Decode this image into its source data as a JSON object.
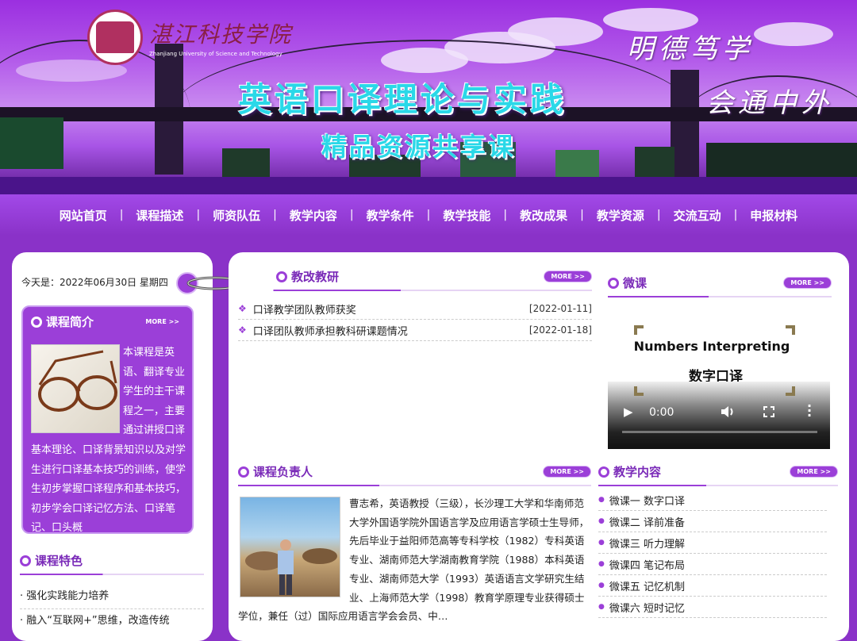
{
  "header": {
    "school_name": "湛江科技学院",
    "school_name_en": "Zhanjiang University of Science and Technology",
    "title": "英语口译理论与实践",
    "subtitle": "精品资源共享课",
    "motto_1": "明德笃学",
    "motto_2": "会通中外"
  },
  "nav": {
    "items": [
      "网站首页",
      "课程描述",
      "师资队伍",
      "教学内容",
      "教学条件",
      "教学技能",
      "教改成果",
      "教学资源",
      "交流互动",
      "申报材料"
    ],
    "separator": "|"
  },
  "sidebar": {
    "date_line": "今天是：2022年06月30日 星期四",
    "intro": {
      "title": "课程简介",
      "more": "MORE >>",
      "text": "本课程是英语、翻译专业学生的主干课程之一，主要通过讲授口译基本理论、口译背景知识以及对学生进行口译基本技巧的训练，使学生初步掌握口译程序和基本技巧，初步学会口译记忆方法、口译笔记、口头概"
    },
    "features": {
      "title": "课程特色",
      "items": [
        "强化实践能力培养",
        "融入“互联网+”思维，改造传统"
      ]
    }
  },
  "reform": {
    "title": "教改教研",
    "more": "MORE >>",
    "items": [
      {
        "title": "口译教学团队教师获奖",
        "date": "[2022-01-11]"
      },
      {
        "title": "口译团队教师承担教科研课题情况",
        "date": "[2022-01-18]"
      }
    ]
  },
  "micro": {
    "title": "微课",
    "more": "MORE >>",
    "video": {
      "title_en": "Numbers Interpreting",
      "title_cn": "数字口译",
      "time": "0:00",
      "progress": 0
    }
  },
  "leader": {
    "title": "课程负责人",
    "more": "MORE >>",
    "bio": "曹志希，英语教授（三级），长沙理工大学和华南师范大学外国语学院外国语言学及应用语言学硕士生导师，先后毕业于益阳师范高等专科学校（1982）专科英语专业、湖南师范大学湖南教育学院（1988）本科英语专业、湖南师范大学（1993）英语语言文学研究生结业、上海师范大学（1998）教育学原理专业获得硕士学位，兼任（过）国际应用语言学会会员、中…"
  },
  "teaching": {
    "title": "教学内容",
    "more": "MORE >>",
    "items": [
      "微课一 数字口译",
      "微课二 译前准备",
      "微课三 听力理解",
      "微课四 笔记布局",
      "微课五 记忆机制",
      "微课六 短时记忆"
    ]
  },
  "colors": {
    "accent": "#9b3fd8",
    "title_cyan": "#2ad8e8"
  }
}
